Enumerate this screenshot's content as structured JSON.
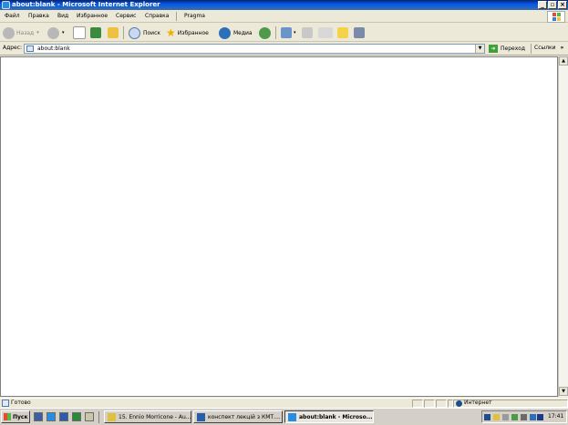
{
  "window": {
    "title": "about:blank - Microsoft Internet Explorer"
  },
  "caption_buttons": {
    "minimize": "_",
    "maximize": "▫",
    "close": "×"
  },
  "menu": [
    "Файл",
    "Правка",
    "Вид",
    "Избранное",
    "Сервис",
    "Справка",
    "Pragma"
  ],
  "toolbar": {
    "back_label": "Назад",
    "search_label": "Поиск",
    "favorites_label": "Избранное",
    "media_label": "Медиа"
  },
  "address": {
    "label": "Адрес:",
    "value": "about:blank",
    "go_label": "Переход",
    "links_label": "Ссылки",
    "chevron": "»"
  },
  "status": {
    "text": "Готово",
    "zone": "Интернет"
  },
  "taskbar": {
    "start_label": "Пуск",
    "tasks": [
      {
        "label": "15. Ennio Morricone - Au..."
      },
      {
        "label": "конспект лекцій з КМТ...."
      },
      {
        "label": "about:blank - Microso..."
      }
    ],
    "clock": "17:41"
  },
  "colors": {
    "title_bar": "#0a246a",
    "accent": "#0058ee",
    "taskbar": "#d4d0c8"
  }
}
